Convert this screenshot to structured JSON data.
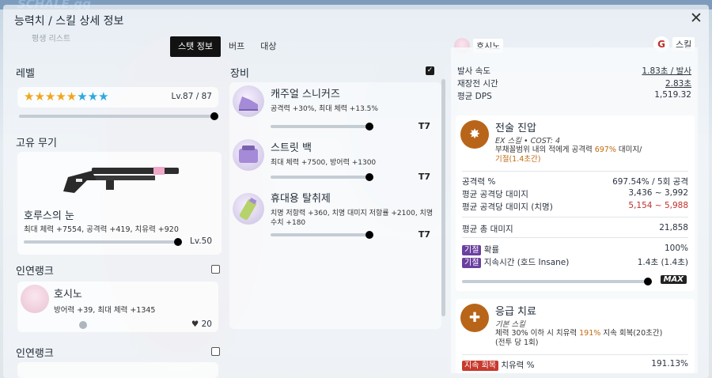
{
  "modal": {
    "title": "능력치 / 스킬 상세 정보",
    "under_title": "평생 리스트",
    "close_glyph": "✕"
  },
  "tabs": [
    {
      "label": "스탯 정보",
      "active": true
    },
    {
      "label": "버프",
      "active": false
    },
    {
      "label": "대상",
      "active": false
    }
  ],
  "level": {
    "label": "레벨",
    "yellow_stars": 5,
    "blue_stars": 3,
    "value_text": "Lv.87 / 87"
  },
  "unique_weapon": {
    "label": "고유 무기",
    "name": "호루스의 눈",
    "stats": "최대 체력 +7554, 공격력 +419, 치유력 +920",
    "level_text": "Lv.50"
  },
  "bond_rank": [
    {
      "label": "인연랭크",
      "student_name": "호시노",
      "stats": "방어력 +39, 최대 체력 +1345",
      "count": "20",
      "checked": false
    },
    {
      "label": "인연랭크",
      "checked": false
    }
  ],
  "equipment": {
    "label": "장비",
    "checked": true,
    "items": [
      {
        "name": "캐주얼 스니커즈",
        "stats": "공격력 +30%, 최대 체력 +13.5%",
        "tier": "T7"
      },
      {
        "name": "스트릿 백",
        "stats": "최대 체력 +7500, 방어력 +1300",
        "tier": "T7"
      },
      {
        "name": "휴대용 탈취제",
        "stats": "치명 저항력 +360, 치명 대미지 저항률 +2100, 치명 수치 +180",
        "tier": "T7"
      }
    ]
  },
  "right_panel": {
    "student_name": "호시노",
    "skill_button": "스킬",
    "stats": [
      {
        "label": "발사 속도",
        "value": "1.83초 / 발사"
      },
      {
        "label": "재장전 시간",
        "value": "2.83초"
      },
      {
        "label": "평균 DPS",
        "value": "1,519.32"
      }
    ],
    "ex_skill": {
      "name": "전술 진압",
      "sub": "EX 스킬 • COST: 4",
      "desc_prefix": "부채꼴범위 내의 적에게 공격력 ",
      "desc_highlight": "697%",
      "desc_suffix": " 대미지/",
      "desc_line2": "기절(1.4초간)",
      "rows": [
        {
          "label": "공격력 %",
          "value": "697.54% / 5회 공격"
        },
        {
          "label": "평균 공격당 대미지",
          "value": "3,436 ~ 3,992"
        },
        {
          "label": "평균 공격당 대미지 (치명)",
          "value": "5,154 ~ 5,988"
        },
        {
          "label": "평균 총 대미지",
          "value": "21,858"
        }
      ],
      "stun_rows": [
        {
          "tag": "기절",
          "label": "확률",
          "value": "100%"
        },
        {
          "tag": "기절",
          "label": "지속시간 (호드 Insane)",
          "value": "1.4초 (1.4초)"
        }
      ],
      "max_label": "MAX"
    },
    "basic_skill": {
      "name": "응급 치료",
      "sub": "기본 스킬",
      "desc_prefix": "체력 30% 이하 시 치유력 ",
      "desc_highlight": "191%",
      "desc_suffix": " 지속 회복(20초간)",
      "desc_line2": "(전투 당 1회)",
      "row": {
        "tag": "지속 회복",
        "label": "치유력 %",
        "value": "191.13%"
      }
    }
  },
  "colors": {
    "accent_black": "#121212",
    "star_yellow": "#f2a51c",
    "star_blue": "#2fa8df",
    "crit_red": "#c0302c",
    "skill_orange": "#b8651a",
    "stun_purple": "#6b3fa0",
    "regen_red": "#c73a2e"
  }
}
